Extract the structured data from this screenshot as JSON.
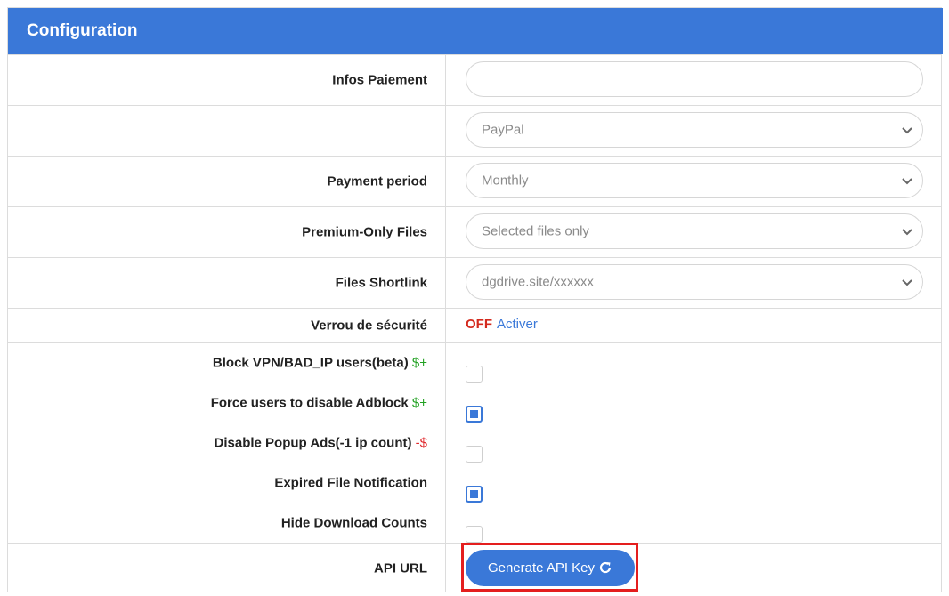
{
  "header": {
    "title": "Configuration"
  },
  "rows": {
    "infos_paiement": {
      "label": "Infos Paiement",
      "value": ""
    },
    "payment_method": {
      "selected": "PayPal"
    },
    "payment_period": {
      "label": "Payment period",
      "selected": "Monthly"
    },
    "premium_only": {
      "label": "Premium-Only Files",
      "selected": "Selected files only"
    },
    "files_shortlink": {
      "label": "Files Shortlink",
      "selected": "dgdrive.site/xxxxxx"
    },
    "security_lock": {
      "label": "Verrou de sécurité",
      "status": "OFF",
      "action": "Activer"
    },
    "block_vpn": {
      "label": "Block VPN/BAD_IP users(beta)",
      "tag": "$+",
      "checked": false
    },
    "force_adblock": {
      "label": "Force users to disable Adblock",
      "tag": "$+",
      "checked": true
    },
    "disable_popup": {
      "label": "Disable Popup Ads(-1 ip count)",
      "tag": "-$",
      "checked": false
    },
    "expired_notification": {
      "label": "Expired File Notification",
      "checked": true
    },
    "hide_download_counts": {
      "label": "Hide Download Counts",
      "checked": false
    },
    "api_url": {
      "label": "API URL",
      "button": "Generate API Key"
    }
  },
  "colors": {
    "accent": "#3a78d8",
    "off_red": "#d42a1e",
    "plus_green": "#21a121",
    "minus_red": "#e0262a",
    "highlight": "#e41e1e"
  },
  "icons": {
    "chevron": "chevron-down-icon",
    "refresh": "refresh-icon"
  }
}
